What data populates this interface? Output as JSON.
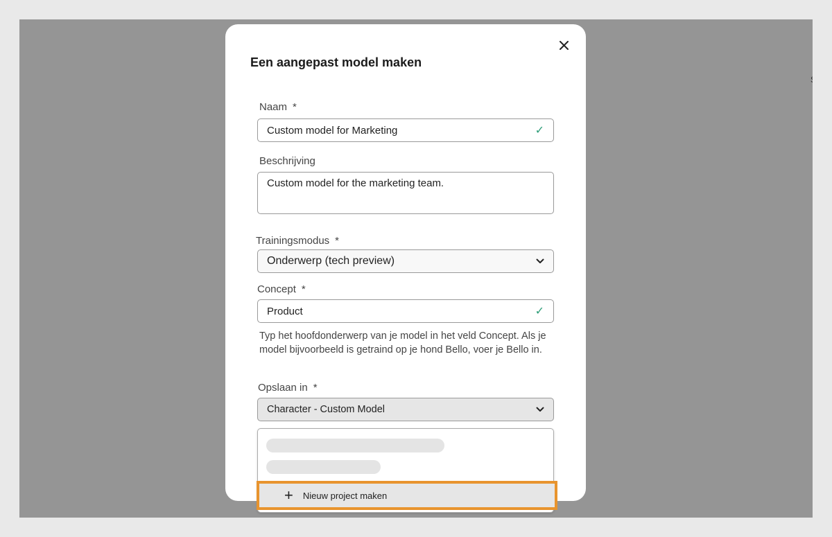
{
  "dialog": {
    "title": "Een aangepast model maken",
    "close_icon": "close-icon"
  },
  "form": {
    "name": {
      "label": "Naam",
      "required_mark": "*",
      "value": "Custom model for Marketing",
      "status_icon": "checkmark-icon"
    },
    "description": {
      "label": "Beschrijving",
      "value": "Custom model for the marketing team."
    },
    "training_mode": {
      "label": "Trainingsmodus",
      "required_mark": "*",
      "selected": "Onderwerp (tech preview)",
      "icon": "chevron-down-icon"
    },
    "concept": {
      "label": "Concept",
      "required_mark": "*",
      "value": "Product",
      "status_icon": "checkmark-icon",
      "helper": "Typ het hoofdonderwerp van je model in het veld Concept. Als je model bijvoorbeeld is getraind op je hond Bello, voer je Bello in."
    },
    "save_in": {
      "label": "Opslaan in",
      "required_mark": "*",
      "selected": "Character - Custom Model",
      "icon": "chevron-down-icon",
      "menu": {
        "loading_placeholders": 2,
        "action_label": "Nieuw project maken",
        "action_icon": "plus-icon"
      }
    }
  },
  "colors": {
    "valid_check": "#2d9d78",
    "highlight_border": "#e8942e",
    "overlay": "#959595"
  },
  "background": {
    "partial_glyph": "S"
  }
}
